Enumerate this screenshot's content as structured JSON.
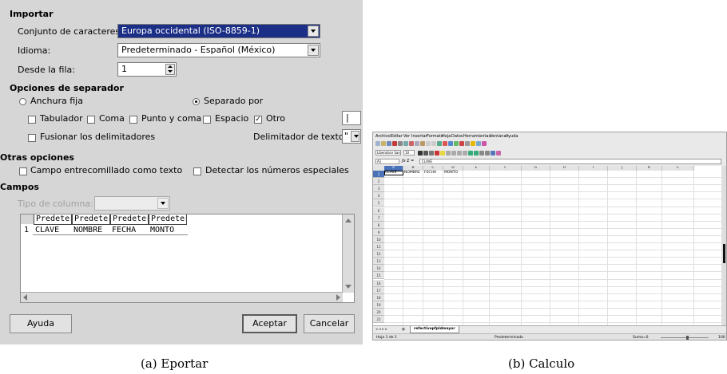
{
  "import_dialog": {
    "section_import": "Importar",
    "charset_label": "Conjunto de caracteres:",
    "charset_value": "Europa occidental (ISO-8859-1)",
    "language_label": "Idioma:",
    "language_value": "Predeterminado - Español (México)",
    "from_row_label": "Desde la fila:",
    "from_row_value": "1",
    "section_separator": "Opciones de separador",
    "fixed_width_label": "Anchura fija",
    "separated_by_label": "Separado por",
    "tab_label": "Tabulador",
    "comma_label": "Coma",
    "semicolon_label": "Punto y coma",
    "space_label": "Espacio",
    "other_label": "Otro",
    "other_value": "|",
    "merge_delimiters_label": "Fusionar los delimitadores",
    "text_delimiter_label": "Delimitador de texto:",
    "text_delimiter_value": "\"",
    "section_other_options": "Otras opciones",
    "quoted_as_text_label": "Campo entrecomillado como texto",
    "detect_special_numbers_label": "Detectar los números especiales",
    "section_fields": "Campos",
    "column_type_label": "Tipo de columna:",
    "grid_headers": [
      "Predeterm",
      "Predeterm",
      "Predeterm",
      "Predeterm"
    ],
    "grid_row_number": "1",
    "grid_row": [
      "CLAVE",
      "NOMBRE",
      "FECHA",
      "MONTO"
    ],
    "help_button": "Ayuda",
    "accept_button": "Aceptar",
    "cancel_button": "Cancelar"
  },
  "captions": {
    "left": "(a) Eportar",
    "right": "(b) Calculo"
  },
  "calc": {
    "menu": [
      "Archivo",
      "Editar",
      "Ver",
      "Insertar",
      "Formato",
      "Hoja",
      "Datos",
      "Herramientas",
      "Ventana",
      "Ayuda"
    ],
    "font_name": "Liberation Sans",
    "font_size": "10",
    "cell_ref": "A1",
    "formula_content": "CLAVE",
    "columns": [
      "A",
      "B",
      "C",
      "D",
      "E",
      "F",
      "G",
      "H",
      "I",
      "J",
      "K",
      "L"
    ],
    "row_numbers": [
      "1",
      "2",
      "3",
      "4",
      "5",
      "6",
      "7",
      "8",
      "9",
      "10",
      "11",
      "12",
      "13",
      "14",
      "15",
      "16",
      "17",
      "18",
      "19",
      "20",
      "21"
    ],
    "row1": [
      "CLAVE",
      "NOMBRE",
      "FECHA",
      "MONTO"
    ],
    "sheet_tab": "refectivepfpldmayor",
    "status_sheet": "Hoja 1 de 1",
    "status_style": "Predeterminado",
    "status_sum": "Suma=0",
    "status_zoom": "100"
  }
}
